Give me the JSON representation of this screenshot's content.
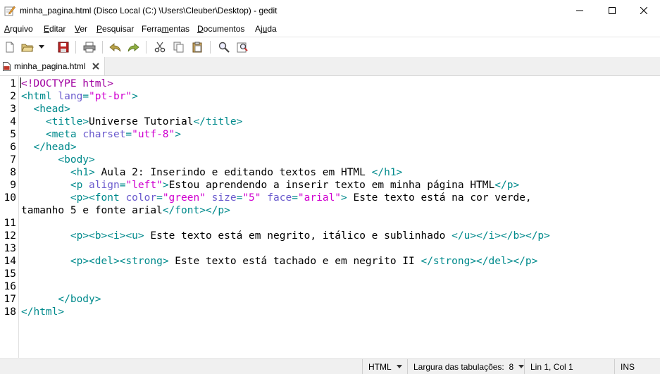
{
  "window": {
    "title": "minha_pagina.html (Disco Local (C:) \\Users\\Cleuber\\Desktop) - gedit"
  },
  "menu": [
    {
      "mnemonic": "A",
      "rest": "rquivo"
    },
    {
      "mnemonic": "E",
      "rest": "ditar"
    },
    {
      "mnemonic": "V",
      "rest": "er"
    },
    {
      "mnemonic": "P",
      "rest": "esquisar"
    },
    {
      "pre": "Ferra",
      "mnemonic": "m",
      "rest": "entas"
    },
    {
      "mnemonic": "D",
      "rest": "ocumentos"
    },
    {
      "pre": "Aj",
      "mnemonic": "u",
      "rest": "da"
    }
  ],
  "toolbar": {
    "icons": [
      "new-document-icon",
      "open-folder-icon",
      "open-dropdown-icon",
      "save-icon",
      "print-icon",
      "undo-icon",
      "redo-icon",
      "cut-icon",
      "copy-icon",
      "paste-icon",
      "find-icon",
      "find-replace-icon"
    ]
  },
  "tab": {
    "label": "minha_pagina.html"
  },
  "editor": {
    "line_numbers": [
      "1",
      "2",
      "3",
      "4",
      "5",
      "6",
      "7",
      "8",
      "9",
      "10",
      "",
      "11",
      "12",
      "13",
      "14",
      "15",
      "16",
      "17",
      "18"
    ]
  },
  "statusbar": {
    "language": "HTML",
    "tab_width_label": "Largura das tabulações:",
    "tab_width_value": "8",
    "position": "Lin 1, Col 1",
    "mode": "INS"
  },
  "colors": {
    "tag": "#008a8c",
    "attribute": "#6a5acd",
    "value": "#d000d0",
    "doctype": "#a000a0"
  }
}
